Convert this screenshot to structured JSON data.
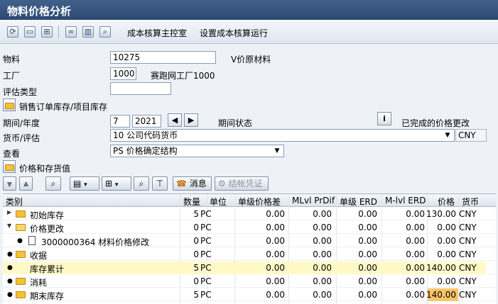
{
  "window": {
    "title": "物料价格分析"
  },
  "toolbar": {
    "cost_cockpit_label": "成本核算主控室",
    "setup_run_label": "设置成本核算运行"
  },
  "form": {
    "material_label": "物料",
    "material_value": "10275",
    "material_desc": "V价原材料",
    "plant_label": "工厂",
    "plant_value": "1000",
    "plant_desc": "赛跑网工厂1000",
    "valuation_type_label": "评估类型",
    "valuation_type_value": "",
    "sales_stock_label": "销售订单库存/项目库存",
    "period_label": "期间/年度",
    "period_value": "7",
    "year_value": "2021",
    "period_status_label": "期间状态",
    "price_change_done_label": "已完成的价格更改",
    "currency_label": "货币/评估",
    "currency_value": "10 公司代码货币",
    "currency_code": "CNY",
    "view_label": "查看",
    "view_value": "PS 价格确定结构",
    "price_stock_label": "价格和存货值"
  },
  "alv_toolbar": {
    "message_label": "消息",
    "post_doc_label": "结帐凭证"
  },
  "grid": {
    "headers": [
      "类别",
      "数量",
      "单位",
      "单级价格差",
      "MLvl PrDif",
      "单级 ERD",
      "M-lvl ERD",
      "价格",
      "货币"
    ],
    "rows": [
      {
        "category": "初始库存",
        "qty": "5",
        "unit": "PC",
        "sl_diff": "0.00",
        "ml_diff": "0.00",
        "sl_erd": "0.00",
        "ml_erd": "0.00",
        "price": "130.00",
        "currency": "CNY"
      },
      {
        "category": "价格更改",
        "qty": "0",
        "unit": "PC",
        "sl_diff": "0.00",
        "ml_diff": "0.00",
        "sl_erd": "0.00",
        "ml_erd": "0.00",
        "price": "0.00",
        "currency": "CNY"
      },
      {
        "category": "3000000364 材料价格修改",
        "qty": "0",
        "unit": "PC",
        "sl_diff": "0.00",
        "ml_diff": "0.00",
        "sl_erd": "0.00",
        "ml_erd": "0.00",
        "price": "0.00",
        "currency": "CNY"
      },
      {
        "category": "收据",
        "qty": "0",
        "unit": "PC",
        "sl_diff": "0.00",
        "ml_diff": "0.00",
        "sl_erd": "0.00",
        "ml_erd": "0.00",
        "price": "0.00",
        "currency": "CNY"
      },
      {
        "category": "库存累计",
        "qty": "5",
        "unit": "PC",
        "sl_diff": "0.00",
        "ml_diff": "0.00",
        "sl_erd": "0.00",
        "ml_erd": "0.00",
        "price": "140.00",
        "currency": "CNY"
      },
      {
        "category": "消耗",
        "qty": "0",
        "unit": "PC",
        "sl_diff": "0.00",
        "ml_diff": "0.00",
        "sl_erd": "0.00",
        "ml_erd": "0.00",
        "price": "0.00",
        "currency": "CNY"
      },
      {
        "category": "期末库存",
        "qty": "5",
        "unit": "PC",
        "sl_diff": "0.00",
        "ml_diff": "0.00",
        "sl_erd": "0.00",
        "ml_erd": "0.00",
        "price": "140.00",
        "currency": "CNY"
      }
    ]
  },
  "colors": {
    "title_bg": "#2d4a72",
    "highlight_row": "#fff9c8",
    "highlight_cell": "#f8c46a"
  }
}
